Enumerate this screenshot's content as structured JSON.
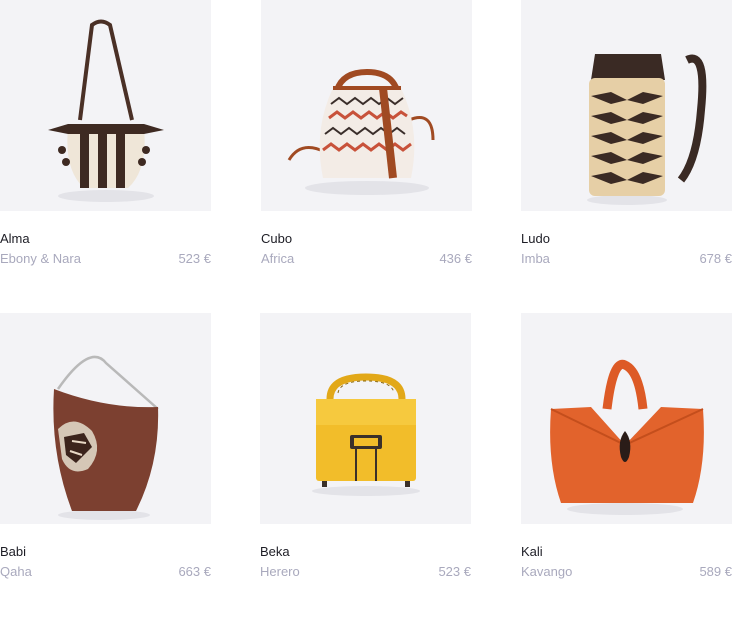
{
  "products": [
    {
      "name": "Alma",
      "variant": "Ebony & Nara",
      "price": "523 €"
    },
    {
      "name": "Cubo",
      "variant": "Africa",
      "price": "436 €"
    },
    {
      "name": "Ludo",
      "variant": "Imba",
      "price": "678 €"
    },
    {
      "name": "Babi",
      "variant": "Qaha",
      "price": "663 €"
    },
    {
      "name": "Beka",
      "variant": "Herero",
      "price": "523 €"
    },
    {
      "name": "Kali",
      "variant": "Kavango",
      "price": "589 €"
    }
  ]
}
